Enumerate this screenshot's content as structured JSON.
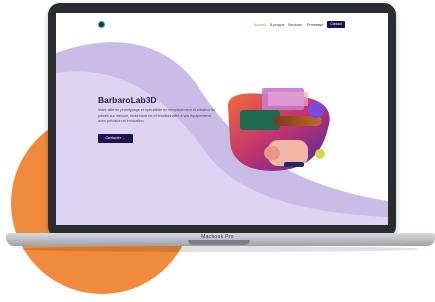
{
  "device": {
    "label": "Macbook Pro"
  },
  "nav": {
    "items": [
      {
        "label": "Accueil",
        "active": true
      },
      {
        "label": "À propos",
        "active": false
      },
      {
        "label": "Services",
        "active": false
      },
      {
        "label": "Promesse",
        "active": false
      }
    ],
    "cta_label": "Contact"
  },
  "hero": {
    "title": "BarbaroLab3D",
    "description": "Votre allié en prototypage et spécialiste en remplacement et création de pièces sur mesure, redonnant vie et fonctionnalité à vos équipements avec précision et innovation.",
    "cta_label": "Contacter →"
  },
  "colors": {
    "accent_orange": "#f08a3c",
    "brand_navy": "#1b1450",
    "lavender": "#c9bde8",
    "nav_active": "#e06a2a"
  },
  "icons": [
    "logo-icon",
    "arrow-right-icon"
  ]
}
